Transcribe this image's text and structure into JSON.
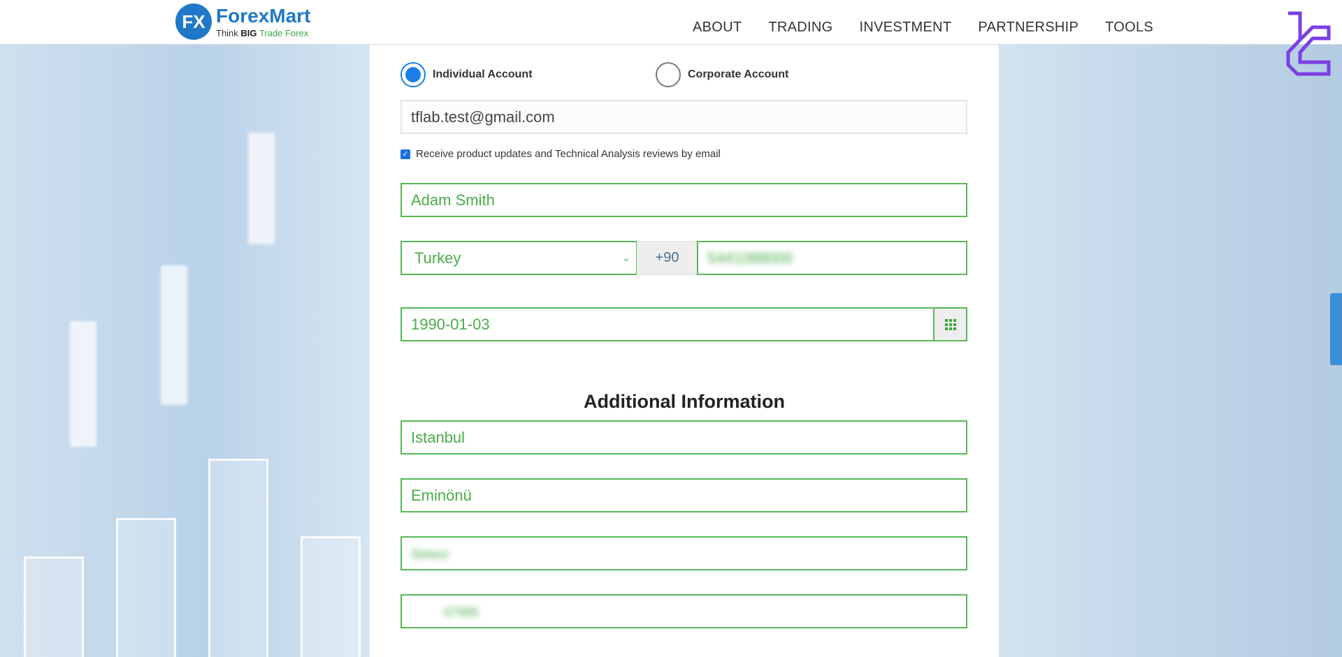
{
  "header": {
    "logo": {
      "mark": "FX",
      "brand": "ForexMart",
      "tagline_1": "Think",
      "tagline_2": "BIG",
      "tagline_3": "Trade Forex"
    },
    "nav": [
      "ABOUT",
      "TRADING",
      "INVESTMENT",
      "PARTNERSHIP",
      "TOOLS"
    ]
  },
  "form": {
    "account_types": [
      {
        "label": "Individual Account",
        "selected": true
      },
      {
        "label": "Corporate Account",
        "selected": false
      }
    ],
    "email": "tflab.test@gmail.com",
    "newsletter": {
      "label": "Receive product updates and Technical Analysis reviews by email",
      "checked": true
    },
    "full_name": "Adam Smith",
    "country": "Turkey",
    "dial_code": "+90",
    "phone": "5441088000",
    "birth_date": "1990-01-03",
    "calendar_icon": "calendar-grid-icon",
    "additional_heading": "Additional Information",
    "city": "Istanbul",
    "district": "Eminönü",
    "street": "Sirkeci",
    "zip": "07995"
  },
  "colors": {
    "accent_green": "#4aac48",
    "brand_blue": "#1f78c8",
    "radio_blue": "#1a7ee8",
    "watermark_purple": "#7b3fe4"
  }
}
